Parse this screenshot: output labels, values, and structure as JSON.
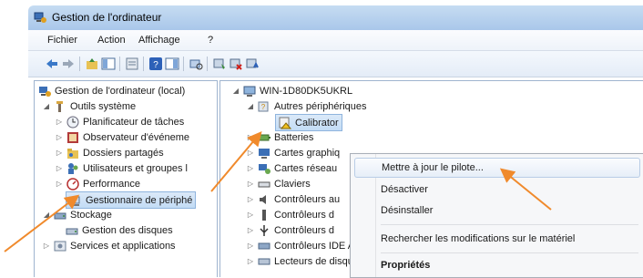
{
  "window": {
    "title": "Gestion de l'ordinateur"
  },
  "menu": [
    "Fichier",
    "Action",
    "Affichage",
    "?"
  ],
  "left_tree": [
    {
      "label": "Gestion de l'ordinateur (local)"
    },
    {
      "label": "Outils système"
    },
    {
      "label": "Planificateur de tâches"
    },
    {
      "label": "Observateur d'événeme"
    },
    {
      "label": "Dossiers partagés"
    },
    {
      "label": "Utilisateurs et groupes l"
    },
    {
      "label": "Performance"
    },
    {
      "label": "Gestionnaire de périphé"
    },
    {
      "label": "Stockage"
    },
    {
      "label": "Gestion des disques"
    },
    {
      "label": "Services et applications"
    }
  ],
  "right_tree": [
    {
      "label": "WIN-1D80DK5UKRL"
    },
    {
      "label": "Autres périphériques"
    },
    {
      "label": "Calibrator"
    },
    {
      "label": "Batteries"
    },
    {
      "label": "Cartes graphiq"
    },
    {
      "label": "Cartes réseau"
    },
    {
      "label": "Claviers"
    },
    {
      "label": "Contrôleurs au"
    },
    {
      "label": "Contrôleurs d"
    },
    {
      "label": "Contrôleurs d"
    },
    {
      "label": "Contrôleurs IDE ATA/ATAPI"
    },
    {
      "label": "Lecteurs de disque"
    }
  ],
  "context_menu": {
    "update_driver": "Mettre à jour le pilote...",
    "disable": "Désactiver",
    "uninstall": "Désinstaller",
    "scan": "Rechercher les modifications sur le matériel",
    "properties": "Propriétés"
  },
  "colors": {
    "arrow": "#f08a2c",
    "selection": "#c3dcf5"
  }
}
